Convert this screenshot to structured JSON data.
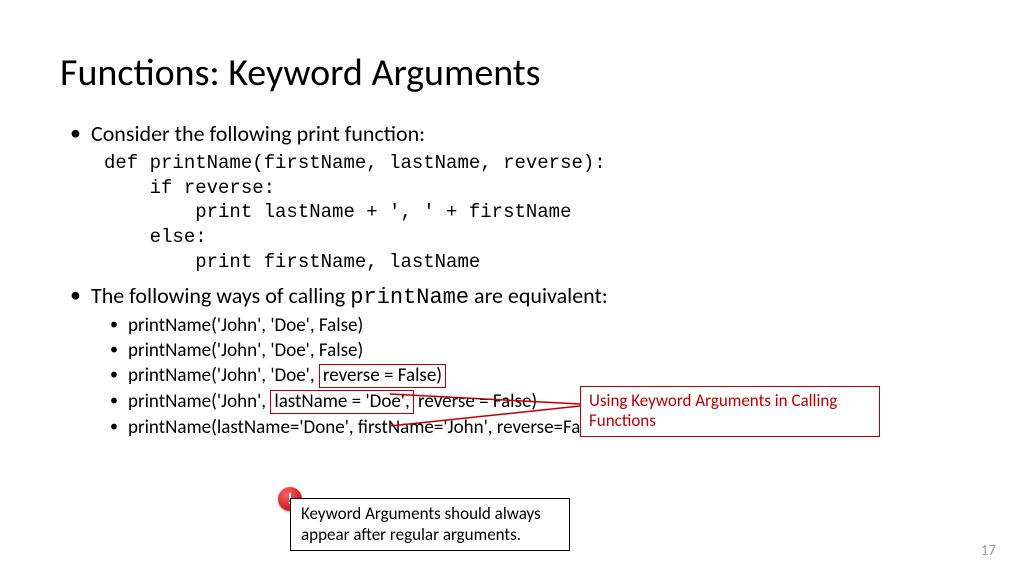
{
  "title": "Functions: Keyword Arguments",
  "bullet1": "Consider the following print function:",
  "code": "def printName(firstName, lastName, reverse):\n    if reverse:\n        print lastName + ', ' + firstName\n    else:\n        print firstName, lastName",
  "bullet2_pre": "The following ways of calling ",
  "bullet2_code": "printName",
  "bullet2_post": " are equivalent:",
  "calls": {
    "c1": "printName('John', 'Doe', False)",
    "c2": "printName('John', 'Doe', False)",
    "c3_pre": "printName('John', 'Doe', ",
    "c3_box": "reverse = False)",
    "c4_pre": "printName('John', ",
    "c4_box": "lastName = 'Doe',",
    "c4_post": " reverse = False)",
    "c5": "printName(lastName='Done', firstName='John', reverse=False)"
  },
  "callout": "Using Keyword Arguments in Calling Functions",
  "note": "Keyword Arguments should always appear after regular arguments.",
  "page": "17"
}
